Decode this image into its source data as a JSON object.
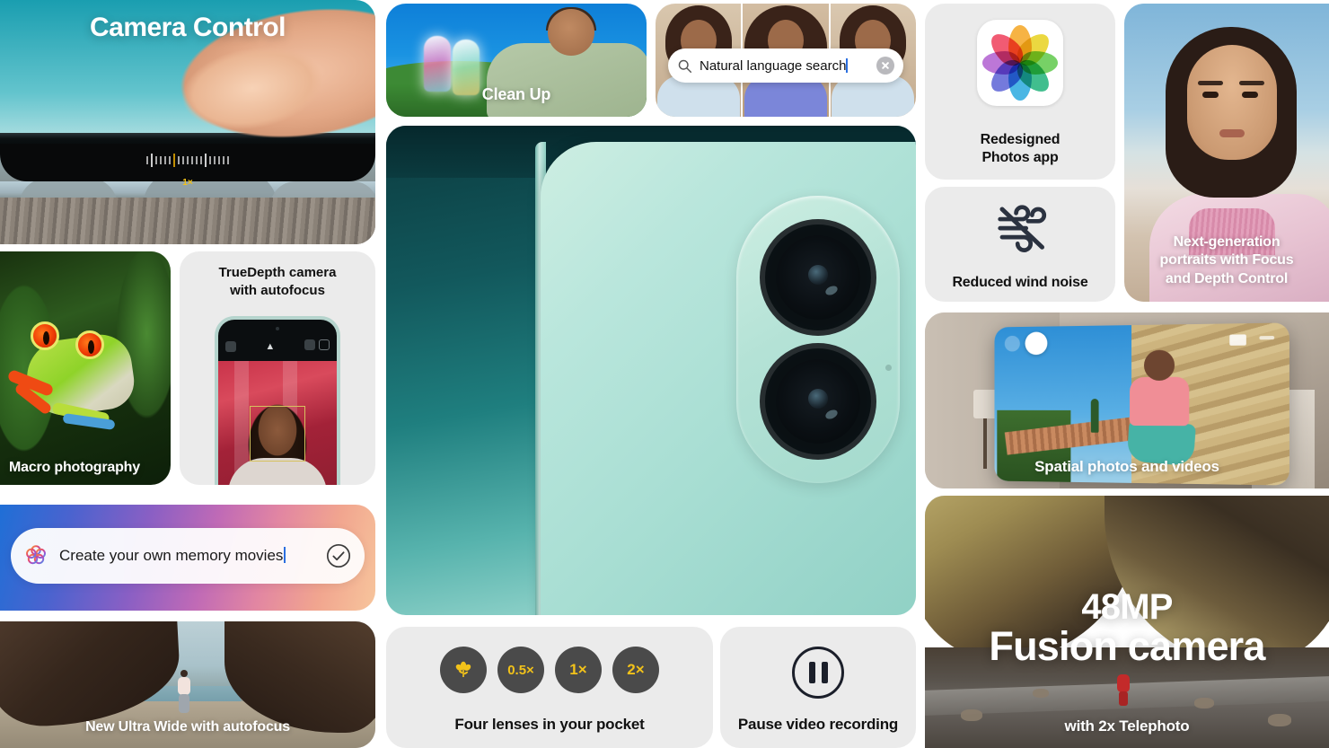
{
  "page": {
    "background": "#ffffff",
    "tile_background": "#ebebeb"
  },
  "tiles": {
    "camera_control": {
      "title": "Camera Control",
      "zoom_indicator": "1×",
      "name": "camera-control-tile"
    },
    "macro": {
      "caption": "Macro photography"
    },
    "truedepth": {
      "title_line1": "TrueDepth camera",
      "title_line2": "with autofocus"
    },
    "memory_movies": {
      "text": "Create your own memory movies",
      "icon": "apple-intelligence-icon",
      "confirm_icon": "check-circle-icon"
    },
    "ultrawide": {
      "caption": "New Ultra Wide with autofocus"
    },
    "clean_up": {
      "caption": "Clean Up"
    },
    "natural_language_search": {
      "search_icon": "search-icon",
      "value": "Natural language search",
      "clear_icon": "clear-circle-icon"
    },
    "hero": {
      "name": "iphone-camera-module-hero"
    },
    "four_lenses": {
      "caption": "Four lenses in your pocket",
      "buttons": [
        {
          "label": "❁",
          "name": "macro-lens-button"
        },
        {
          "label": "0.5×",
          "name": "ultrawide-lens-button"
        },
        {
          "label": "1×",
          "name": "wide-lens-button"
        },
        {
          "label": "2×",
          "name": "telephoto-lens-button"
        }
      ],
      "button_color": "#4a4a4a",
      "label_color": "#f2c21a"
    },
    "pause_video": {
      "caption": "Pause video recording",
      "icon": "pause-circle-icon"
    },
    "photos_app": {
      "caption_line1": "Redesigned",
      "caption_line2": "Photos app",
      "icon": "photos-app-icon"
    },
    "wind_noise": {
      "caption": "Reduced wind noise",
      "icon": "wind-slash-icon"
    },
    "portrait": {
      "caption_line1": "Next-generation",
      "caption_line2": "portraits with Focus",
      "caption_line3": "and Depth Control"
    },
    "spatial": {
      "caption": "Spatial photos and videos"
    },
    "fusion": {
      "title_line1": "48MP",
      "title_line2": "Fusion camera",
      "caption": "with 2x Telephoto"
    }
  }
}
